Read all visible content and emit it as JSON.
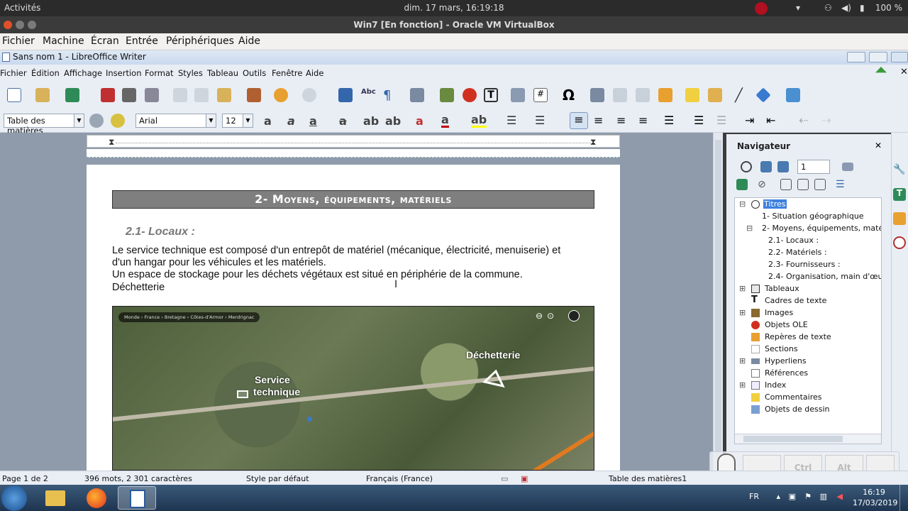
{
  "topbar": {
    "activities": "Activités",
    "clock": "dim. 17 mars, 16:19:18",
    "battery": "100 %"
  },
  "vbox": {
    "title": "Win7 [En fonction] - Oracle VM VirtualBox",
    "menu": [
      "Fichier",
      "Machine",
      "Écran",
      "Entrée",
      "Périphériques",
      "Aide"
    ]
  },
  "writer": {
    "title": "Sans nom 1 - LibreOffice Writer",
    "menu": [
      "Fichier",
      "Édition",
      "Affichage",
      "Insertion",
      "Format",
      "Styles",
      "Tableau",
      "Outils",
      "Fenêtre",
      "Aide"
    ],
    "paragraph_style": "Table des matières",
    "font_name": "Arial",
    "font_size": "12"
  },
  "document": {
    "heading": "2- Moyens, équipements, matériels",
    "subheading": "2.1-   Locaux :",
    "lines": [
      "Le service technique est composé d'un entrepôt de matériel (mécanique, électricité, menuiserie) et",
      "d'un hangar pour les véhicules et les matériels.",
      "Un espace de stockage pour les déchets végétaux est situé en périphérie de la commune.",
      "Déchetterie"
    ],
    "map": {
      "breadcrumb": "Monde › France › Bretagne › Côtes-d'Armor › Merdrignac",
      "label_service": "Service",
      "label_service2": "technique",
      "label_dechetterie": "Déchetterie"
    }
  },
  "navigator": {
    "title": "Navigateur",
    "page_value": "1",
    "items": [
      {
        "label": "Titres",
        "level": 0,
        "icon": "headings-icon",
        "expander": "⊟"
      },
      {
        "label": "1- Situation géographique",
        "level": 1
      },
      {
        "label": "2- Moyens, équipements, matérie",
        "level": 1,
        "expander": "⊟"
      },
      {
        "label": "2.1- Locaux :",
        "level": 2
      },
      {
        "label": "2.2- Matériels :",
        "level": 2
      },
      {
        "label": "2.3- Fournisseurs :",
        "level": 2
      },
      {
        "label": "2.4- Organisation, main d'œuvre",
        "level": 2
      },
      {
        "label": "Tableaux",
        "level": 0,
        "icon": "table-icon",
        "expander": "⊞"
      },
      {
        "label": "Cadres de texte",
        "level": 0,
        "icon": "text-frame-icon"
      },
      {
        "label": "Images",
        "level": 0,
        "icon": "image-icon",
        "expander": "⊞"
      },
      {
        "label": "Objets OLE",
        "level": 0,
        "icon": "ole-object-icon"
      },
      {
        "label": "Repères de texte",
        "level": 0,
        "icon": "bookmark-icon"
      },
      {
        "label": "Sections",
        "level": 0,
        "icon": "section-icon"
      },
      {
        "label": "Hyperliens",
        "level": 0,
        "icon": "hyperlink-icon",
        "expander": "⊞"
      },
      {
        "label": "Références",
        "level": 0,
        "icon": "reference-icon"
      },
      {
        "label": "Index",
        "level": 0,
        "icon": "index-icon",
        "expander": "⊞"
      },
      {
        "label": "Commentaires",
        "level": 0,
        "icon": "comment-icon"
      },
      {
        "label": "Objets de dessin",
        "level": 0,
        "icon": "drawing-object-icon"
      }
    ]
  },
  "status": {
    "page": "Page 1 de 2",
    "words": "396 mots, 2 301 caractères",
    "style": "Style par défaut",
    "language": "Français (France)",
    "section": "Table des matières1"
  },
  "osk": {
    "ctrl": "Ctrl",
    "alt": "Alt"
  },
  "taskbar": {
    "lang": "FR",
    "time": "16:19",
    "date": "17/03/2019"
  },
  "colors": {
    "heading_bg": "#7f7f7f",
    "taskbar": "#1e3550",
    "nav_selected": "#3d80df"
  }
}
